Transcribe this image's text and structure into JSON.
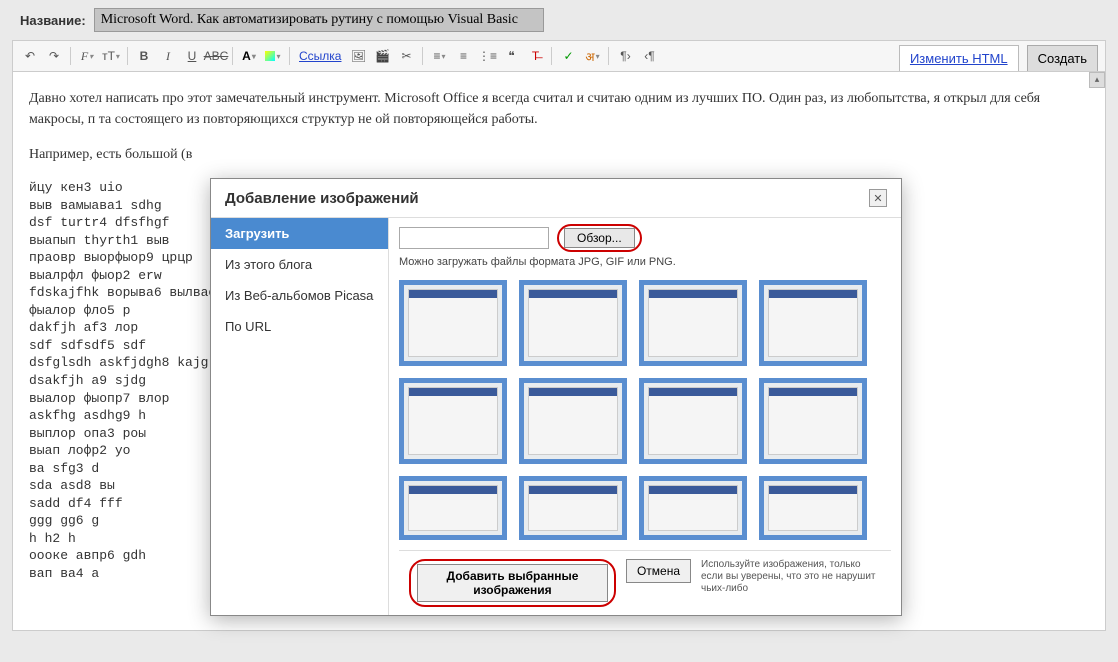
{
  "title_label": "Название:",
  "title_value": "Microsoft Word. Как автоматизировать рутину с помощью Visual Basic",
  "top_buttons": {
    "edit_html": "Изменить HTML",
    "create": "Создать"
  },
  "toolbar": {
    "link_label": "Ссылка",
    "font_f": "F",
    "size_t": "тТ",
    "bold": "B",
    "italic": "I",
    "underline": "U",
    "strike": "ABC",
    "textcolor": "A"
  },
  "editor": {
    "para1": "Давно хотел написать про этот замечательный инструмент. Microsoft Office я всегда считал и считаю одним из лучших ПО. Один раз, из любопытства, я открыл для себя макросы, п                                                                                                                                                                                                                          та состоящего из повторяющихся структур не                                                                                                                                                                                                                     ой повторяющейся работы.",
    "para2": "Например, есть большой (в",
    "mono": "йцу кен3 uio\nвыв вамыава1 sdhg\ndsf turtr4 dfsfhgf\nвыапып thyrth1 выв\nпраовр выорфыор9 црцр\nвыалрфл фыор2 erw\nfdskajfhk ворыва6 вылвао\nфыалор фло5 р\ndakfjh аf3 лор\nsdf sdfsdf5 sdf\ndsfglsdh askfjdgh8 kajg\ndsakfjh а9 sjdg\nвыалор фыопр7 влор\naskfhg asdhg9 h\nвыплор опа3 роы\nвыап лофр2 уо\nва sfg3 d\nsda asd8 вы\nsadd df4 fff\nggg gg6 g\nh h2 h\nоооке авпр6 gdh\nвап ва4 а"
  },
  "dialog": {
    "title": "Добавление изображений",
    "sidebar": {
      "upload": "Загрузить",
      "from_blog": "Из этого блога",
      "from_picasa": "Из Веб-альбомов Picasa",
      "by_url": "По URL"
    },
    "browse": "Обзор...",
    "hint": "Можно загружать файлы формата JPG, GIF или PNG.",
    "add_selected": "Добавить выбранные изображения",
    "cancel": "Отмена",
    "footer_hint": "Используйте изображения, только если вы уверены, что это не нарушит чьих-либо"
  }
}
